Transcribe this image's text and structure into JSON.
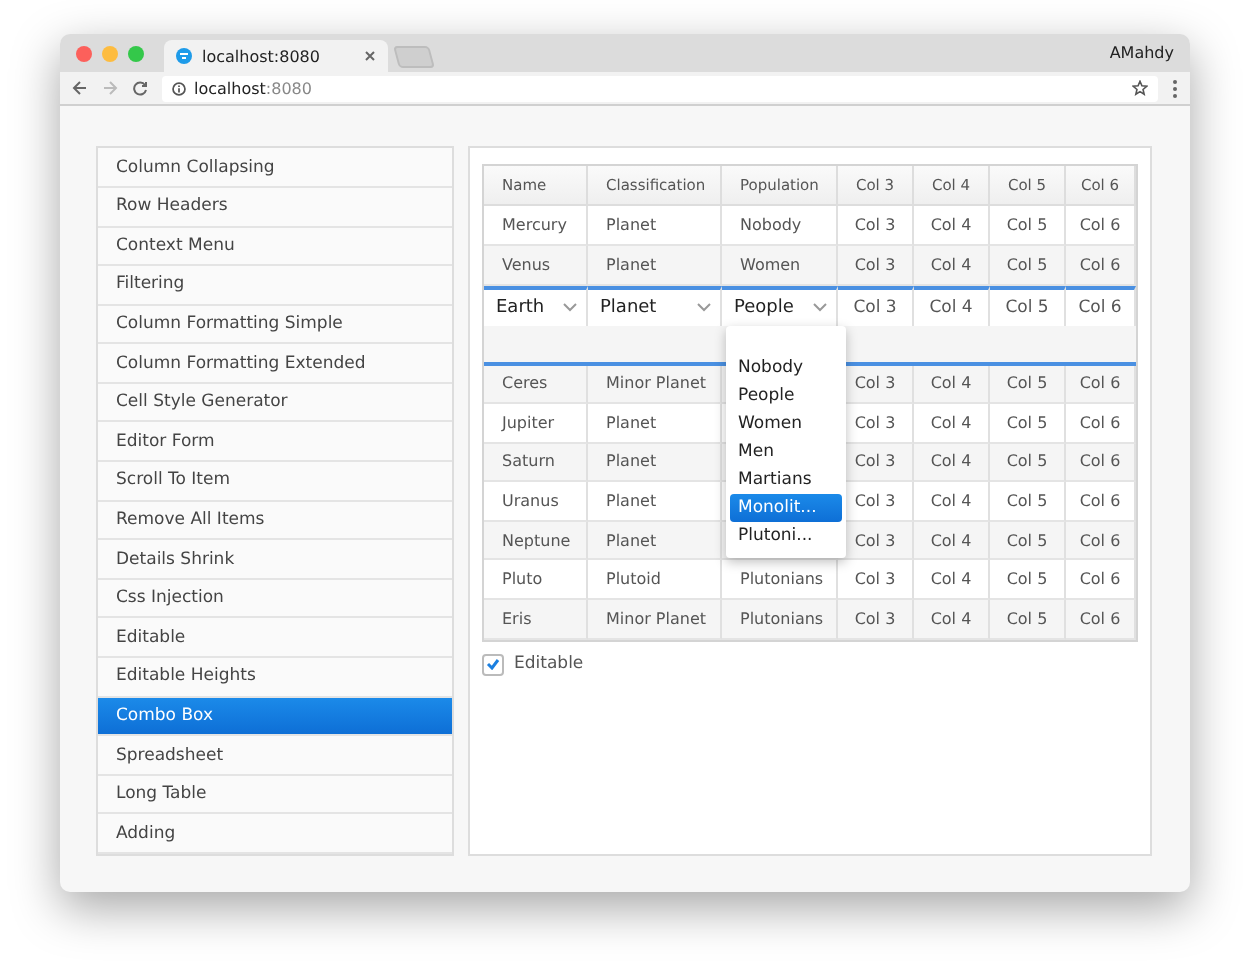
{
  "browser": {
    "tab_title": "localhost:8080",
    "user": "AMahdy",
    "address_host": "localhost",
    "address_port": ":8080"
  },
  "sidebar": {
    "items": [
      {
        "label": "Column Collapsing",
        "selected": false
      },
      {
        "label": "Row Headers",
        "selected": false
      },
      {
        "label": "Context Menu",
        "selected": false
      },
      {
        "label": "Filtering",
        "selected": false
      },
      {
        "label": "Column Formatting Simple",
        "selected": false
      },
      {
        "label": "Column Formatting Extended",
        "selected": false
      },
      {
        "label": "Cell Style Generator",
        "selected": false
      },
      {
        "label": "Editor Form",
        "selected": false
      },
      {
        "label": "Scroll To Item",
        "selected": false
      },
      {
        "label": "Remove All Items",
        "selected": false
      },
      {
        "label": "Details Shrink",
        "selected": false
      },
      {
        "label": "Css Injection",
        "selected": false
      },
      {
        "label": "Editable",
        "selected": false
      },
      {
        "label": "Editable Heights",
        "selected": false
      },
      {
        "label": "Combo Box",
        "selected": true
      },
      {
        "label": "Spreadsheet",
        "selected": false
      },
      {
        "label": "Long Table",
        "selected": false
      },
      {
        "label": "Adding",
        "selected": false
      }
    ]
  },
  "table": {
    "columns": [
      "Name",
      "Classification",
      "Population",
      "Col 3",
      "Col 4",
      "Col 5",
      "Col 6"
    ],
    "rows": [
      {
        "kind": "data",
        "cells": [
          "Mercury",
          "Planet",
          "Nobody",
          "Col 3",
          "Col 4",
          "Col 5",
          "Col 6"
        ]
      },
      {
        "kind": "data",
        "cells": [
          "Venus",
          "Planet",
          "Women",
          "Col 3",
          "Col 4",
          "Col 5",
          "Col 6"
        ]
      },
      {
        "kind": "editor",
        "cells": [
          "Earth",
          "Planet",
          "People",
          "Col 3",
          "Col 4",
          "Col 5",
          "Col 6"
        ]
      },
      {
        "kind": "details"
      },
      {
        "kind": "data",
        "cells": [
          "Ceres",
          "Minor Planet",
          null,
          "Col 3",
          "Col 4",
          "Col 5",
          "Col 6"
        ]
      },
      {
        "kind": "data",
        "cells": [
          "Jupiter",
          "Planet",
          null,
          "Col 3",
          "Col 4",
          "Col 5",
          "Col 6"
        ]
      },
      {
        "kind": "data",
        "cells": [
          "Saturn",
          "Planet",
          null,
          "Col 3",
          "Col 4",
          "Col 5",
          "Col 6"
        ]
      },
      {
        "kind": "data",
        "cells": [
          "Uranus",
          "Planet",
          null,
          "Col 3",
          "Col 4",
          "Col 5",
          "Col 6"
        ]
      },
      {
        "kind": "data",
        "cells": [
          "Neptune",
          "Planet",
          null,
          "Col 3",
          "Col 4",
          "Col 5",
          "Col 6"
        ]
      },
      {
        "kind": "data",
        "cells": [
          "Pluto",
          "Plutoid",
          "Plutonians",
          "Col 3",
          "Col 4",
          "Col 5",
          "Col 6"
        ]
      },
      {
        "kind": "data",
        "cells": [
          "Eris",
          "Minor Planet",
          "Plutonians",
          "Col 3",
          "Col 4",
          "Col 5",
          "Col 6"
        ]
      }
    ]
  },
  "dropdown": {
    "options": [
      {
        "label": "Nobody",
        "selected": false
      },
      {
        "label": "People",
        "selected": false
      },
      {
        "label": "Women",
        "selected": false
      },
      {
        "label": "Men",
        "selected": false
      },
      {
        "label": "Martians",
        "selected": false
      },
      {
        "label": "Monolit...",
        "selected": true
      },
      {
        "label": "Plutoni...",
        "selected": false
      }
    ]
  },
  "editable": {
    "label": "Editable",
    "checked": true
  }
}
